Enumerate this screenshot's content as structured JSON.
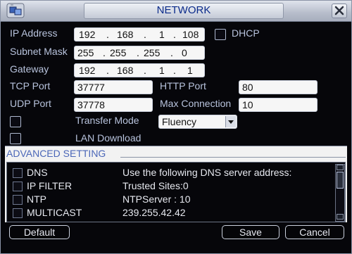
{
  "window": {
    "title": "NETWORK"
  },
  "fields": {
    "ip_label": "IP Address",
    "ip": [
      "192",
      "168",
      "1",
      "108"
    ],
    "dhcp_label": "DHCP",
    "subnet_label": "Subnet Mask",
    "subnet": [
      "255",
      "255",
      "255",
      "0"
    ],
    "gateway_label": "Gateway",
    "gateway": [
      "192",
      "168",
      "1",
      "1"
    ],
    "tcp_label": "TCP Port",
    "tcp": "37777",
    "http_label": "HTTP Port",
    "http": "80",
    "udp_label": "UDP Port",
    "udp": "37778",
    "maxconn_label": "Max Connection",
    "maxconn": "10",
    "transfer_label": "Transfer Mode",
    "transfer_value": "Fluency",
    "lan_label": "LAN Download"
  },
  "advanced": {
    "title": "ADVANCED SETTING",
    "rows": [
      {
        "name": "DNS",
        "value": "Use the following DNS server address:"
      },
      {
        "name": "IP FILTER",
        "value": "Trusted Sites:0"
      },
      {
        "name": "NTP",
        "value": "NTPServer : 10"
      },
      {
        "name": "MULTICAST",
        "value": "239.255.42.42"
      }
    ]
  },
  "buttons": {
    "default": "Default",
    "save": "Save",
    "cancel": "Cancel"
  },
  "icons": {
    "app": "network-settings-icon",
    "close": "close-icon"
  },
  "colors": {
    "label": "#b8c3dd",
    "title": "#0a2a8a",
    "advanced_title": "#4b67b8"
  }
}
